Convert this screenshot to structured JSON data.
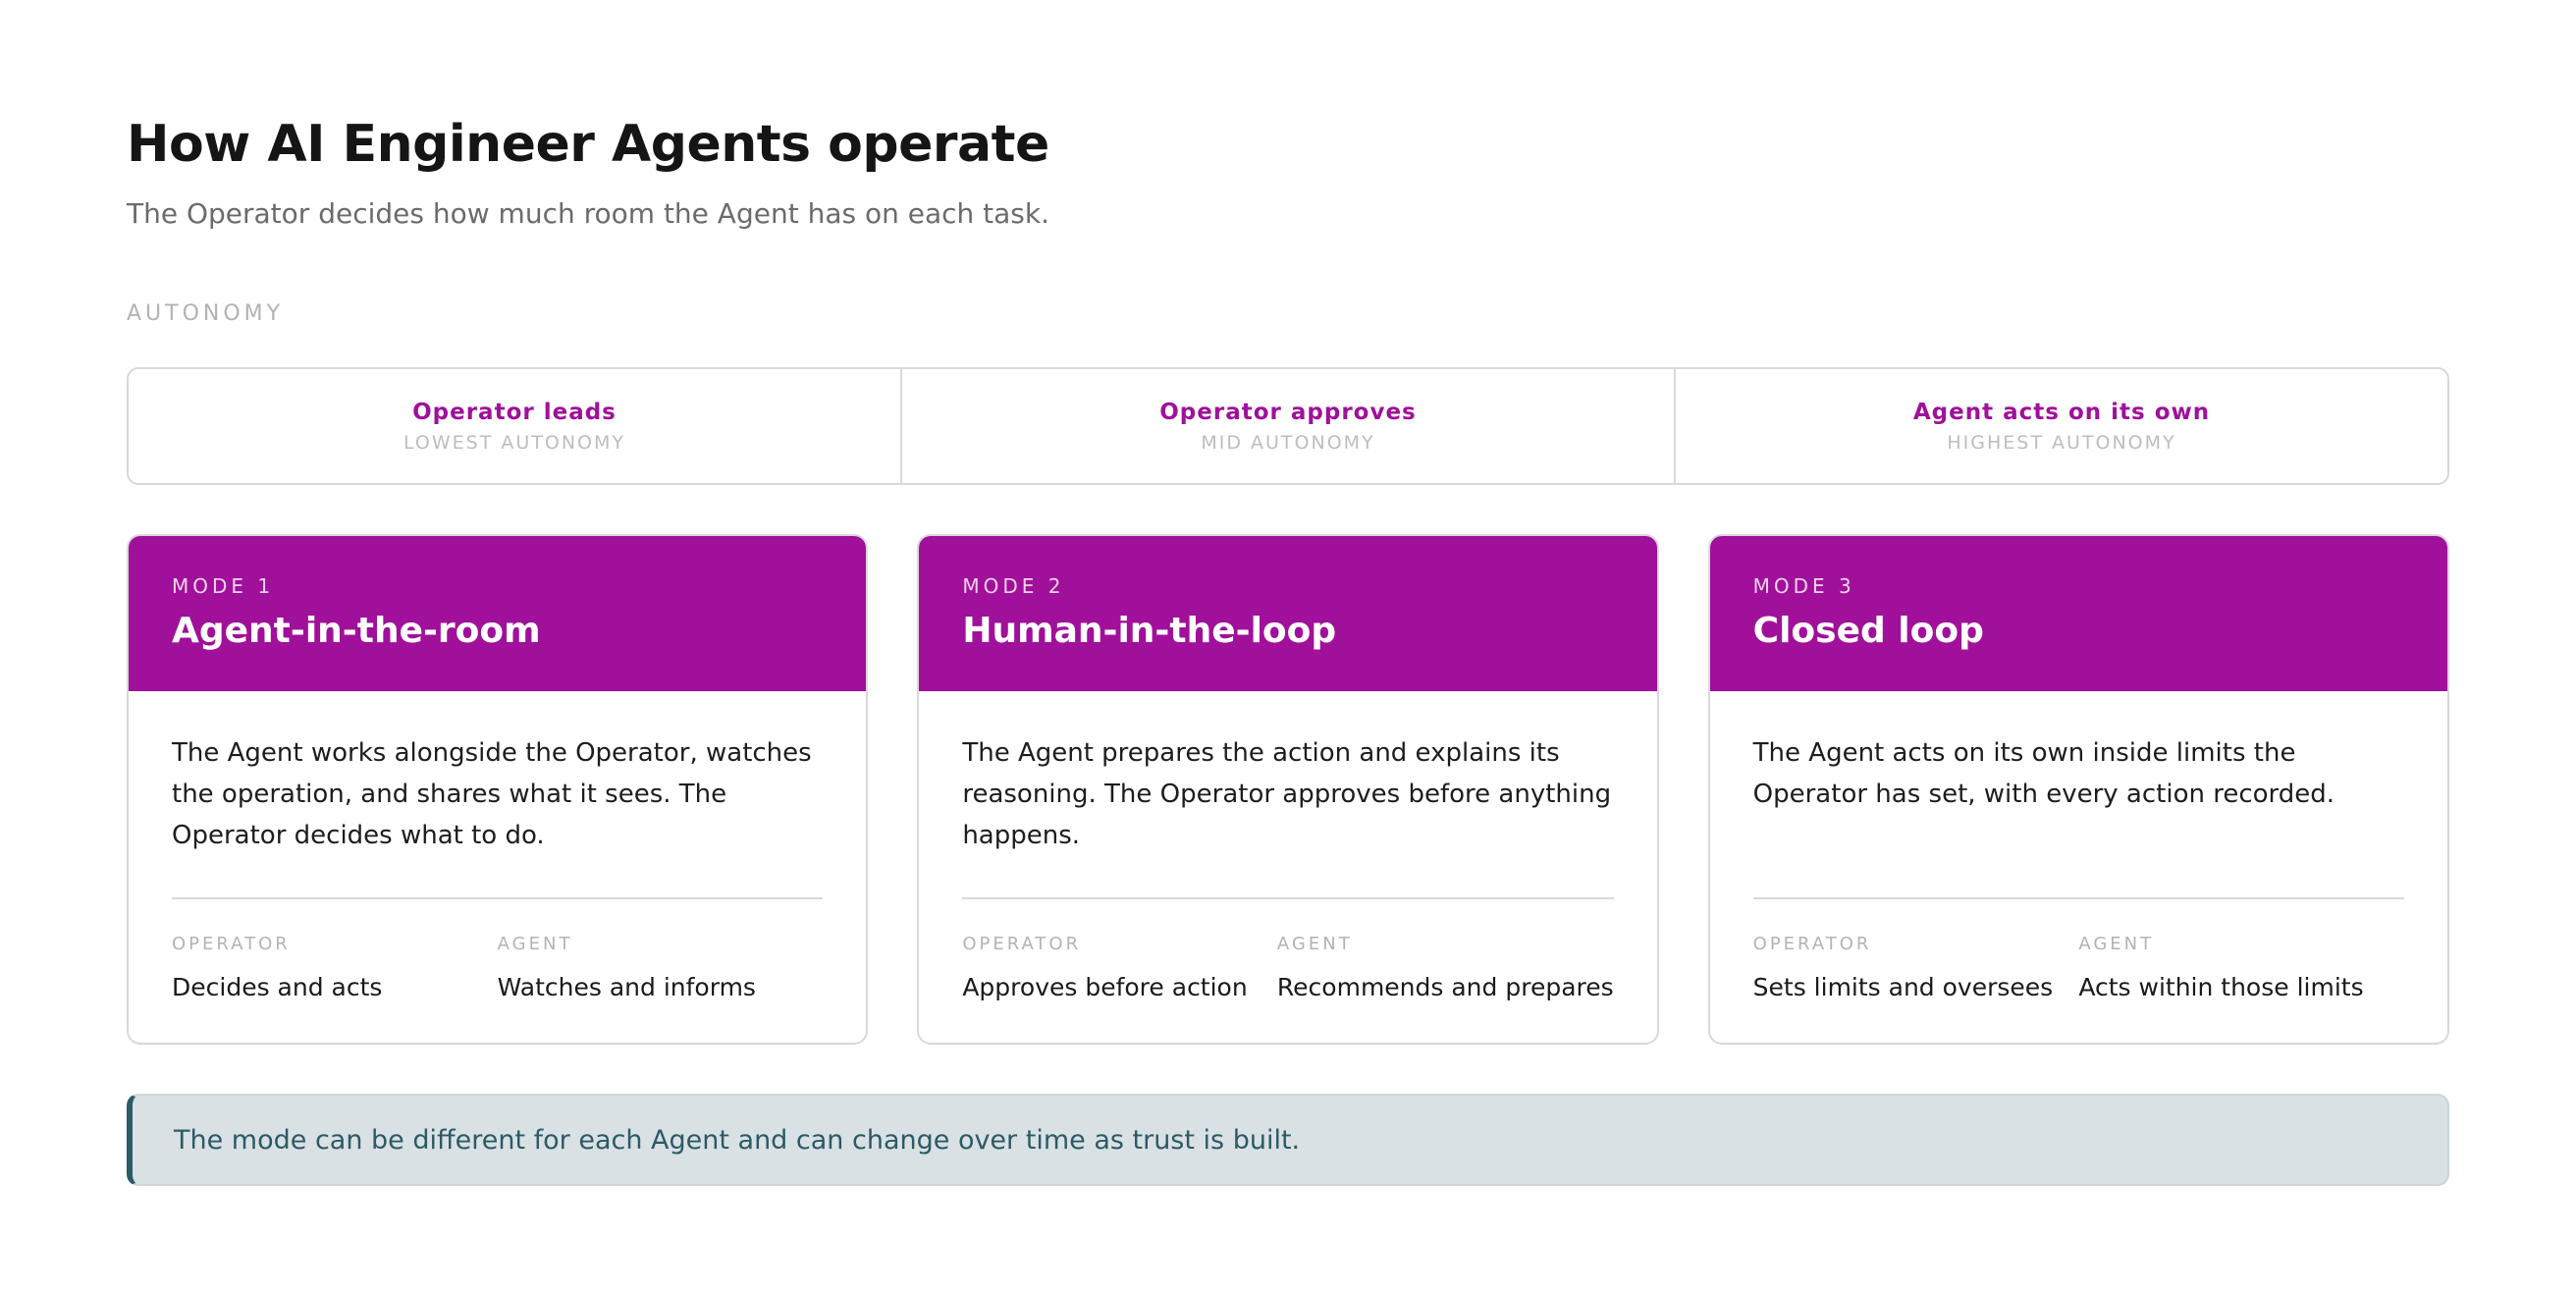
{
  "header": {
    "title": "How AI Engineer Agents operate",
    "subtitle": "The Operator decides how much room the Agent has on each task."
  },
  "autonomy": {
    "label": "AUTONOMY",
    "scale": [
      {
        "title": "Operator leads",
        "level": "LOWEST AUTONOMY"
      },
      {
        "title": "Operator approves",
        "level": "MID AUTONOMY"
      },
      {
        "title": "Agent acts on its own",
        "level": "HIGHEST AUTONOMY"
      }
    ]
  },
  "modes": [
    {
      "label": "MODE 1",
      "title": "Agent-in-the-room",
      "description": "The Agent works alongside the Operator, watches the operation, and shares what it sees. The Operator decides what to do.",
      "operator_label": "OPERATOR",
      "operator_role": "Decides and acts",
      "agent_label": "AGENT",
      "agent_role": "Watches and informs"
    },
    {
      "label": "MODE 2",
      "title": "Human-in-the-loop",
      "description": "The Agent prepares the action and explains its reasoning. The Operator approves before anything happens.",
      "operator_label": "OPERATOR",
      "operator_role": "Approves before action",
      "agent_label": "AGENT",
      "agent_role": "Recommends and prepares"
    },
    {
      "label": "MODE 3",
      "title": "Closed loop",
      "description": "The Agent acts on its own inside limits the Operator has set, with every action recorded.",
      "operator_label": "OPERATOR",
      "operator_role": "Sets limits and oversees",
      "agent_label": "AGENT",
      "agent_role": "Acts within those limits"
    }
  ],
  "note": "The mode can be different for each Agent and can change over time as trust is built.",
  "colors": {
    "accent": "#a0109a",
    "note_bg": "#d9e1e4",
    "note_text": "#2c5a66",
    "border": "#d8d8de"
  }
}
